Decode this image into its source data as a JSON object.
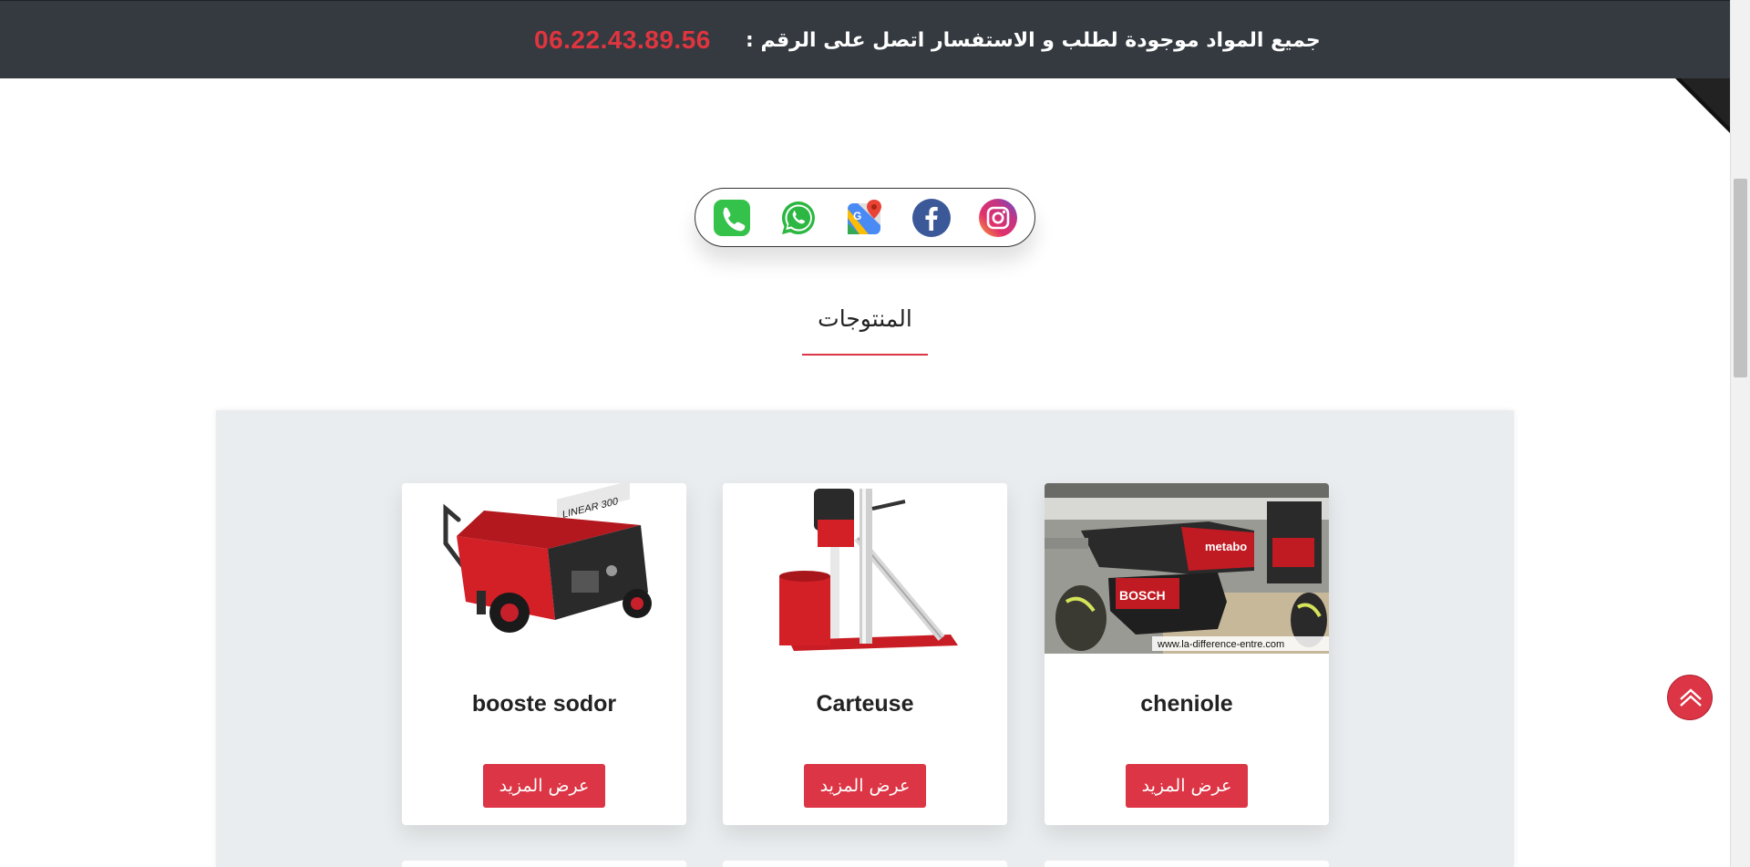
{
  "top_bar": {
    "message": "جميع المواد موجودة لطلب و الاستفسار اتصل على الرقم :",
    "phone": "06.22.43.89.56"
  },
  "social_links": [
    {
      "name": "instagram-icon"
    },
    {
      "name": "facebook-icon"
    },
    {
      "name": "google-maps-icon"
    },
    {
      "name": "whatsapp-icon"
    },
    {
      "name": "phone-icon"
    }
  ],
  "section": {
    "title": "المنتوجات"
  },
  "products": [
    {
      "title": "booste sodor",
      "button_label": "عرض المزيد"
    },
    {
      "title": "Carteuse",
      "button_label": "عرض المزيد"
    },
    {
      "title": "cheniole",
      "button_label": "عرض المزيد"
    }
  ],
  "colors": {
    "top_bar_bg": "#343a40",
    "accent": "#dc3545",
    "panel_bg": "#eaedef"
  }
}
